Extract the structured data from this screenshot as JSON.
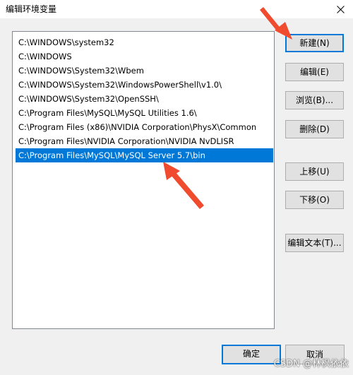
{
  "window": {
    "title": "编辑环境变量",
    "close_icon": "close-icon"
  },
  "path_list": {
    "items": [
      "C:\\WINDOWS\\system32",
      "C:\\WINDOWS",
      "C:\\WINDOWS\\System32\\Wbem",
      "C:\\WINDOWS\\System32\\WindowsPowerShell\\v1.0\\",
      "C:\\WINDOWS\\System32\\OpenSSH\\",
      "C:\\Program Files\\MySQL\\MySQL Utilities 1.6\\",
      "C:\\Program Files (x86)\\NVIDIA Corporation\\PhysX\\Common",
      "C:\\Program Files\\NVIDIA Corporation\\NVIDIA NvDLISR",
      "C:\\Program Files\\MySQL\\MySQL Server 5.7\\bin"
    ],
    "selected_index": 8,
    "selection_color": "#0078d7"
  },
  "buttons": {
    "new": "新建(N)",
    "edit": "编辑(E)",
    "browse": "浏览(B)...",
    "delete": "删除(D)",
    "move_up": "上移(U)",
    "move_down": "下移(O)",
    "edit_text": "编辑文本(T)...",
    "ok": "确定",
    "cancel": "取消"
  },
  "annotations": {
    "arrow_color": "#f04a2f"
  },
  "watermark": "CSDN @林枫依依"
}
